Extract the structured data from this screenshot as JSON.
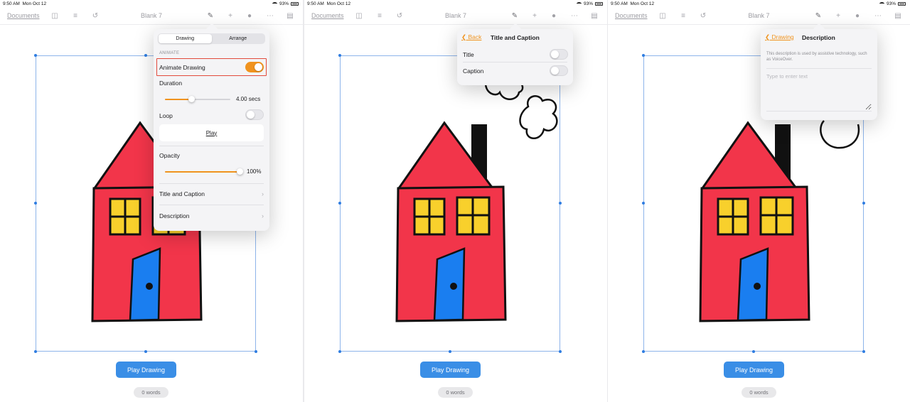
{
  "status_bar": {
    "time": "9:50 AM",
    "date": "Mon Oct 12",
    "battery": "93%"
  },
  "toolbar": {
    "documents_label": "Documents",
    "doc_title": "Blank 7",
    "icons": [
      "sidebar-icon",
      "list-icon",
      "undo-icon",
      "paintbrush-icon",
      "plus-icon",
      "collaborate-icon",
      "more-icon",
      "document-icon"
    ]
  },
  "canvas": {
    "play_drawing_label": "Play Drawing",
    "word_count": "0 words",
    "house_colors": {
      "body": "#f2354a",
      "roof": "#f2354a",
      "window": "#f8d02c",
      "door": "#1a7ef0",
      "chimney": "#111111"
    }
  },
  "pane1_popover": {
    "tabs": [
      {
        "label": "Drawing",
        "active": true
      },
      {
        "label": "Arrange",
        "active": false
      }
    ],
    "section_label": "ANIMATE",
    "animate_drawing_label": "Animate Drawing",
    "animate_drawing_on": true,
    "duration_label": "Duration",
    "duration_value": "4.00 secs",
    "duration_fraction": 0.4,
    "loop_label": "Loop",
    "loop_on": false,
    "play_label": "Play",
    "opacity_label": "Opacity",
    "opacity_value": "100%",
    "opacity_fraction": 1.0,
    "title_caption_label": "Title and Caption",
    "description_label": "Description"
  },
  "pane2_popover": {
    "back_label": "Back",
    "title": "Title and Caption",
    "title_row_label": "Title",
    "caption_row_label": "Caption",
    "title_on": false,
    "caption_on": false
  },
  "pane3_popover": {
    "back_label": "Drawing",
    "title": "Description",
    "help_text": "This description is used by assistive technology, such as VoiceOver.",
    "input_placeholder": "Type to enter text"
  },
  "colors": {
    "accent": "#f0931e",
    "selection": "#2f7de1",
    "play_button": "#3a8ee6",
    "highlight": "#e24a3b"
  }
}
